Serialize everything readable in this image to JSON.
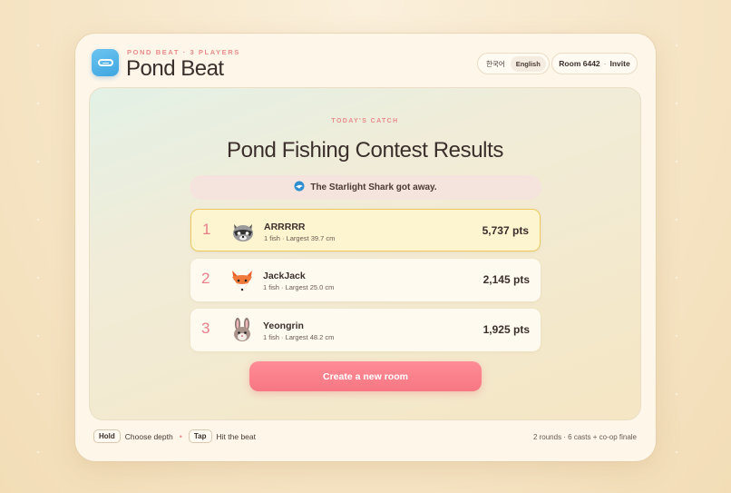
{
  "header": {
    "kicker": "POND BEAT · 3 PLAYERS",
    "title": "Pond Beat",
    "languages": [
      {
        "label": "한국어",
        "active": false
      },
      {
        "label": "English",
        "active": true
      }
    ],
    "room_label": "Room 6442",
    "invite_label": "Invite",
    "separator": "·"
  },
  "results": {
    "kicker": "TODAY'S CATCH",
    "title": "Pond Fishing Contest Results",
    "notice_icon": "shark-icon",
    "notice": "The Starlight Shark got away.",
    "players": [
      {
        "rank": "1",
        "name": "ARRRRR",
        "meta": "1 fish · Largest 39.7 cm",
        "points": "5,737 pts",
        "avatar": "raccoon-icon"
      },
      {
        "rank": "2",
        "name": "JackJack",
        "meta": "1 fish · Largest 25.0 cm",
        "points": "2,145 pts",
        "avatar": "fox-icon"
      },
      {
        "rank": "3",
        "name": "Yeongrin",
        "meta": "1 fish · Largest 48.2 cm",
        "points": "1,925 pts",
        "avatar": "rabbit-icon"
      }
    ],
    "create_button": "Create a new room"
  },
  "footer": {
    "hold_key": "Hold",
    "hold_action": "Choose depth",
    "bullet": "•",
    "tap_key": "Tap",
    "tap_action": "Hit the beat",
    "summary": "2 rounds · 6 casts + co-op finale"
  },
  "colors": {
    "accent": "#f67783",
    "highlight_border": "#ecc95e",
    "brand_icon": "#3fa6e0"
  }
}
